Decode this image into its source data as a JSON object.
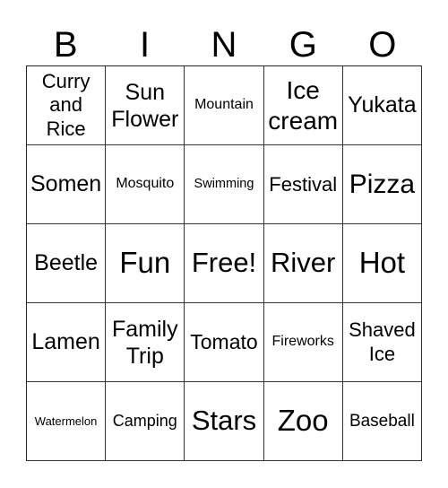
{
  "header": [
    "B",
    "I",
    "N",
    "G",
    "O"
  ],
  "cells": [
    [
      "Curry and Rice",
      "Sun Flower",
      "Mountain",
      "Ice cream",
      "Yukata"
    ],
    [
      "Somen",
      "Mosquito",
      "Swimming",
      "Festival",
      "Pizza"
    ],
    [
      "Beetle",
      "Fun",
      "Free!",
      "River",
      "Hot"
    ],
    [
      "Lamen",
      "Family Trip",
      "Tomato",
      "Fireworks",
      "Shaved Ice"
    ],
    [
      "Watermelon",
      "Camping",
      "Stars",
      "Zoo",
      "Baseball"
    ]
  ]
}
